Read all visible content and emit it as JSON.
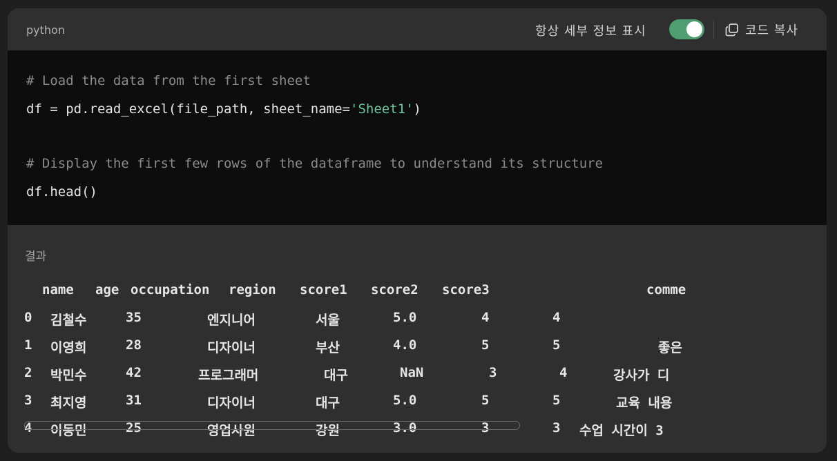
{
  "header": {
    "language": "python",
    "toggle_label": "항상 세부 정보 표시",
    "toggle_on": true,
    "copy_label": "코드 복사",
    "copy_icon": "copy-icon"
  },
  "code": {
    "comment1": "# Load the data from the first sheet",
    "line2_prefix": "df = pd.read_excel(file_path, sheet_name=",
    "line2_string": "'Sheet1'",
    "line2_suffix": ")",
    "comment2": "# Display the first few rows of the dataframe to understand its structure",
    "line4": "df.head()"
  },
  "result": {
    "label": "결과",
    "columns": [
      "name",
      "age",
      "occupation",
      "region",
      "score1",
      "score2",
      "score3",
      "comme"
    ],
    "rows": [
      {
        "index": "0",
        "name": "김철수",
        "age": "35",
        "occupation": "엔지니어",
        "region": "서울",
        "score1": "5.0",
        "score2": "4",
        "score3": "4",
        "comment": ""
      },
      {
        "index": "1",
        "name": "이영희",
        "age": "28",
        "occupation": "디자이너",
        "region": "부산",
        "score1": "4.0",
        "score2": "5",
        "score3": "5",
        "comment": "좋은"
      },
      {
        "index": "2",
        "name": "박민수",
        "age": "42",
        "occupation": "프로그래머",
        "region": "대구",
        "score1": "NaN",
        "score2": "3",
        "score3": "4",
        "comment": "강사가 디"
      },
      {
        "index": "3",
        "name": "최지영",
        "age": "31",
        "occupation": "디자이너",
        "region": "대구",
        "score1": "5.0",
        "score2": "5",
        "score3": "5",
        "comment": "교육 내용"
      },
      {
        "index": "4",
        "name": "이동민",
        "age": "25",
        "occupation": "영업사원",
        "region": "강원",
        "score1": "3.0",
        "score2": "3",
        "score3": "3",
        "comment": "수업 시간이 3"
      }
    ]
  },
  "colors": {
    "toggle_on": "#4f9f72",
    "code_bg": "#0d0d0d",
    "string": "#6fc59f",
    "comment": "#8b8b8b"
  }
}
